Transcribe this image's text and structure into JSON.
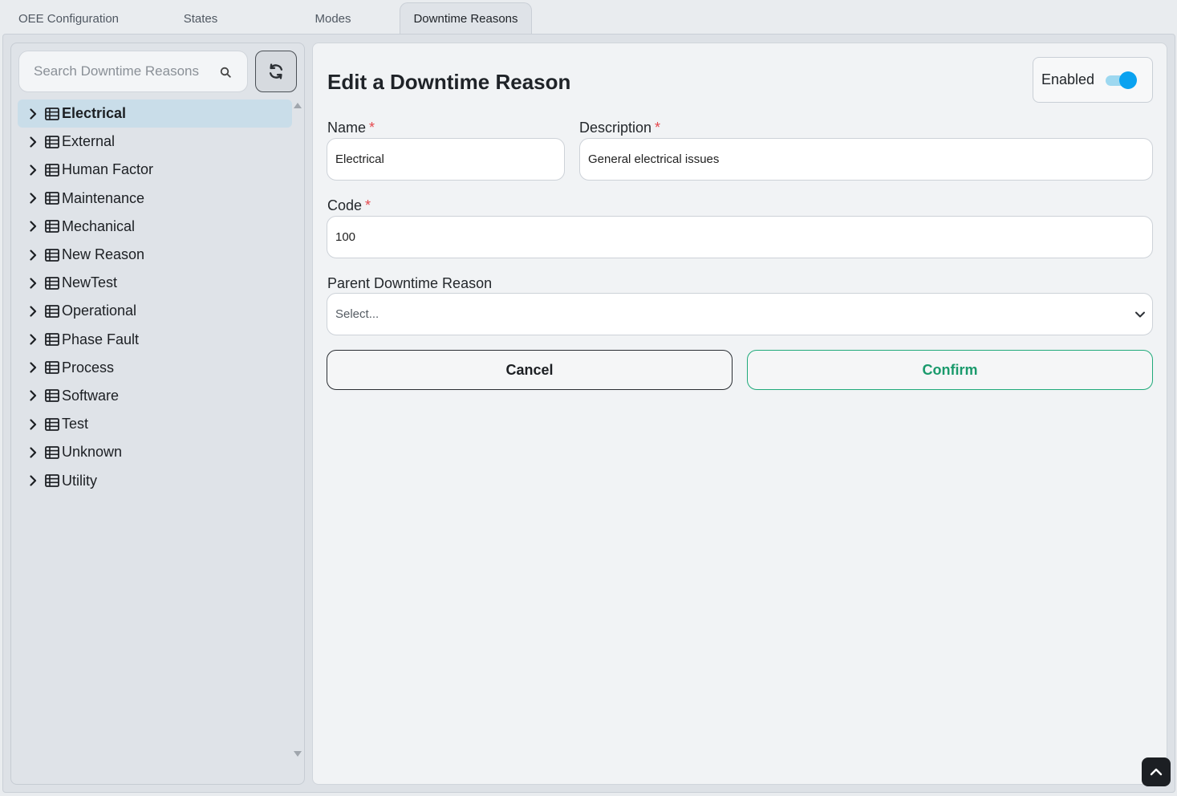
{
  "tabs": [
    {
      "label": "OEE Configuration",
      "active": false
    },
    {
      "label": "States",
      "active": false
    },
    {
      "label": "Modes",
      "active": false
    },
    {
      "label": "Downtime Reasons",
      "active": true
    }
  ],
  "sidebar": {
    "search_placeholder": "Search Downtime Reasons",
    "search_icon": "search-icon",
    "refresh_icon": "refresh-icon",
    "items": [
      {
        "label": "Electrical",
        "selected": true
      },
      {
        "label": "External"
      },
      {
        "label": "Human Factor"
      },
      {
        "label": "Maintenance"
      },
      {
        "label": "Mechanical"
      },
      {
        "label": "New Reason"
      },
      {
        "label": "NewTest"
      },
      {
        "label": "Operational"
      },
      {
        "label": "Phase Fault"
      },
      {
        "label": "Process"
      },
      {
        "label": "Software"
      },
      {
        "label": "Test"
      },
      {
        "label": "Unknown"
      },
      {
        "label": "Utility"
      }
    ]
  },
  "form": {
    "title": "Edit a Downtime Reason",
    "enabled_label": "Enabled",
    "enabled": true,
    "name_label": "Name",
    "name_value": "Electrical",
    "description_label": "Description",
    "description_value": "General electrical issues",
    "code_label": "Code",
    "code_value": "100",
    "required_marker": "*",
    "parent_label": "Parent Downtime Reason",
    "parent_placeholder": "Select...",
    "cancel_label": "Cancel",
    "confirm_label": "Confirm"
  },
  "colors": {
    "accent_toggle": "#0aa2f0",
    "confirm_green": "#1a9a6c",
    "required_red": "#e5484d",
    "selected_row": "#c9dde9"
  }
}
